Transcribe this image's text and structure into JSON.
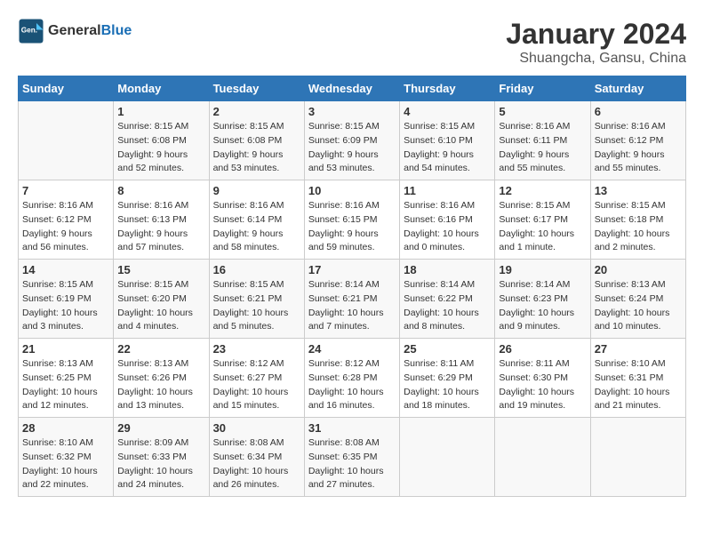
{
  "header": {
    "logo_general": "General",
    "logo_blue": "Blue",
    "title": "January 2024",
    "subtitle": "Shuangcha, Gansu, China"
  },
  "calendar": {
    "weekdays": [
      "Sunday",
      "Monday",
      "Tuesday",
      "Wednesday",
      "Thursday",
      "Friday",
      "Saturday"
    ],
    "weeks": [
      [
        {
          "day": "",
          "sunrise": "",
          "sunset": "",
          "daylight": ""
        },
        {
          "day": "1",
          "sunrise": "Sunrise: 8:15 AM",
          "sunset": "Sunset: 6:08 PM",
          "daylight": "Daylight: 9 hours and 52 minutes."
        },
        {
          "day": "2",
          "sunrise": "Sunrise: 8:15 AM",
          "sunset": "Sunset: 6:08 PM",
          "daylight": "Daylight: 9 hours and 53 minutes."
        },
        {
          "day": "3",
          "sunrise": "Sunrise: 8:15 AM",
          "sunset": "Sunset: 6:09 PM",
          "daylight": "Daylight: 9 hours and 53 minutes."
        },
        {
          "day": "4",
          "sunrise": "Sunrise: 8:15 AM",
          "sunset": "Sunset: 6:10 PM",
          "daylight": "Daylight: 9 hours and 54 minutes."
        },
        {
          "day": "5",
          "sunrise": "Sunrise: 8:16 AM",
          "sunset": "Sunset: 6:11 PM",
          "daylight": "Daylight: 9 hours and 55 minutes."
        },
        {
          "day": "6",
          "sunrise": "Sunrise: 8:16 AM",
          "sunset": "Sunset: 6:12 PM",
          "daylight": "Daylight: 9 hours and 55 minutes."
        }
      ],
      [
        {
          "day": "7",
          "sunrise": "Sunrise: 8:16 AM",
          "sunset": "Sunset: 6:12 PM",
          "daylight": "Daylight: 9 hours and 56 minutes."
        },
        {
          "day": "8",
          "sunrise": "Sunrise: 8:16 AM",
          "sunset": "Sunset: 6:13 PM",
          "daylight": "Daylight: 9 hours and 57 minutes."
        },
        {
          "day": "9",
          "sunrise": "Sunrise: 8:16 AM",
          "sunset": "Sunset: 6:14 PM",
          "daylight": "Daylight: 9 hours and 58 minutes."
        },
        {
          "day": "10",
          "sunrise": "Sunrise: 8:16 AM",
          "sunset": "Sunset: 6:15 PM",
          "daylight": "Daylight: 9 hours and 59 minutes."
        },
        {
          "day": "11",
          "sunrise": "Sunrise: 8:16 AM",
          "sunset": "Sunset: 6:16 PM",
          "daylight": "Daylight: 10 hours and 0 minutes."
        },
        {
          "day": "12",
          "sunrise": "Sunrise: 8:15 AM",
          "sunset": "Sunset: 6:17 PM",
          "daylight": "Daylight: 10 hours and 1 minute."
        },
        {
          "day": "13",
          "sunrise": "Sunrise: 8:15 AM",
          "sunset": "Sunset: 6:18 PM",
          "daylight": "Daylight: 10 hours and 2 minutes."
        }
      ],
      [
        {
          "day": "14",
          "sunrise": "Sunrise: 8:15 AM",
          "sunset": "Sunset: 6:19 PM",
          "daylight": "Daylight: 10 hours and 3 minutes."
        },
        {
          "day": "15",
          "sunrise": "Sunrise: 8:15 AM",
          "sunset": "Sunset: 6:20 PM",
          "daylight": "Daylight: 10 hours and 4 minutes."
        },
        {
          "day": "16",
          "sunrise": "Sunrise: 8:15 AM",
          "sunset": "Sunset: 6:21 PM",
          "daylight": "Daylight: 10 hours and 5 minutes."
        },
        {
          "day": "17",
          "sunrise": "Sunrise: 8:14 AM",
          "sunset": "Sunset: 6:21 PM",
          "daylight": "Daylight: 10 hours and 7 minutes."
        },
        {
          "day": "18",
          "sunrise": "Sunrise: 8:14 AM",
          "sunset": "Sunset: 6:22 PM",
          "daylight": "Daylight: 10 hours and 8 minutes."
        },
        {
          "day": "19",
          "sunrise": "Sunrise: 8:14 AM",
          "sunset": "Sunset: 6:23 PM",
          "daylight": "Daylight: 10 hours and 9 minutes."
        },
        {
          "day": "20",
          "sunrise": "Sunrise: 8:13 AM",
          "sunset": "Sunset: 6:24 PM",
          "daylight": "Daylight: 10 hours and 10 minutes."
        }
      ],
      [
        {
          "day": "21",
          "sunrise": "Sunrise: 8:13 AM",
          "sunset": "Sunset: 6:25 PM",
          "daylight": "Daylight: 10 hours and 12 minutes."
        },
        {
          "day": "22",
          "sunrise": "Sunrise: 8:13 AM",
          "sunset": "Sunset: 6:26 PM",
          "daylight": "Daylight: 10 hours and 13 minutes."
        },
        {
          "day": "23",
          "sunrise": "Sunrise: 8:12 AM",
          "sunset": "Sunset: 6:27 PM",
          "daylight": "Daylight: 10 hours and 15 minutes."
        },
        {
          "day": "24",
          "sunrise": "Sunrise: 8:12 AM",
          "sunset": "Sunset: 6:28 PM",
          "daylight": "Daylight: 10 hours and 16 minutes."
        },
        {
          "day": "25",
          "sunrise": "Sunrise: 8:11 AM",
          "sunset": "Sunset: 6:29 PM",
          "daylight": "Daylight: 10 hours and 18 minutes."
        },
        {
          "day": "26",
          "sunrise": "Sunrise: 8:11 AM",
          "sunset": "Sunset: 6:30 PM",
          "daylight": "Daylight: 10 hours and 19 minutes."
        },
        {
          "day": "27",
          "sunrise": "Sunrise: 8:10 AM",
          "sunset": "Sunset: 6:31 PM",
          "daylight": "Daylight: 10 hours and 21 minutes."
        }
      ],
      [
        {
          "day": "28",
          "sunrise": "Sunrise: 8:10 AM",
          "sunset": "Sunset: 6:32 PM",
          "daylight": "Daylight: 10 hours and 22 minutes."
        },
        {
          "day": "29",
          "sunrise": "Sunrise: 8:09 AM",
          "sunset": "Sunset: 6:33 PM",
          "daylight": "Daylight: 10 hours and 24 minutes."
        },
        {
          "day": "30",
          "sunrise": "Sunrise: 8:08 AM",
          "sunset": "Sunset: 6:34 PM",
          "daylight": "Daylight: 10 hours and 26 minutes."
        },
        {
          "day": "31",
          "sunrise": "Sunrise: 8:08 AM",
          "sunset": "Sunset: 6:35 PM",
          "daylight": "Daylight: 10 hours and 27 minutes."
        },
        {
          "day": "",
          "sunrise": "",
          "sunset": "",
          "daylight": ""
        },
        {
          "day": "",
          "sunrise": "",
          "sunset": "",
          "daylight": ""
        },
        {
          "day": "",
          "sunrise": "",
          "sunset": "",
          "daylight": ""
        }
      ]
    ]
  }
}
